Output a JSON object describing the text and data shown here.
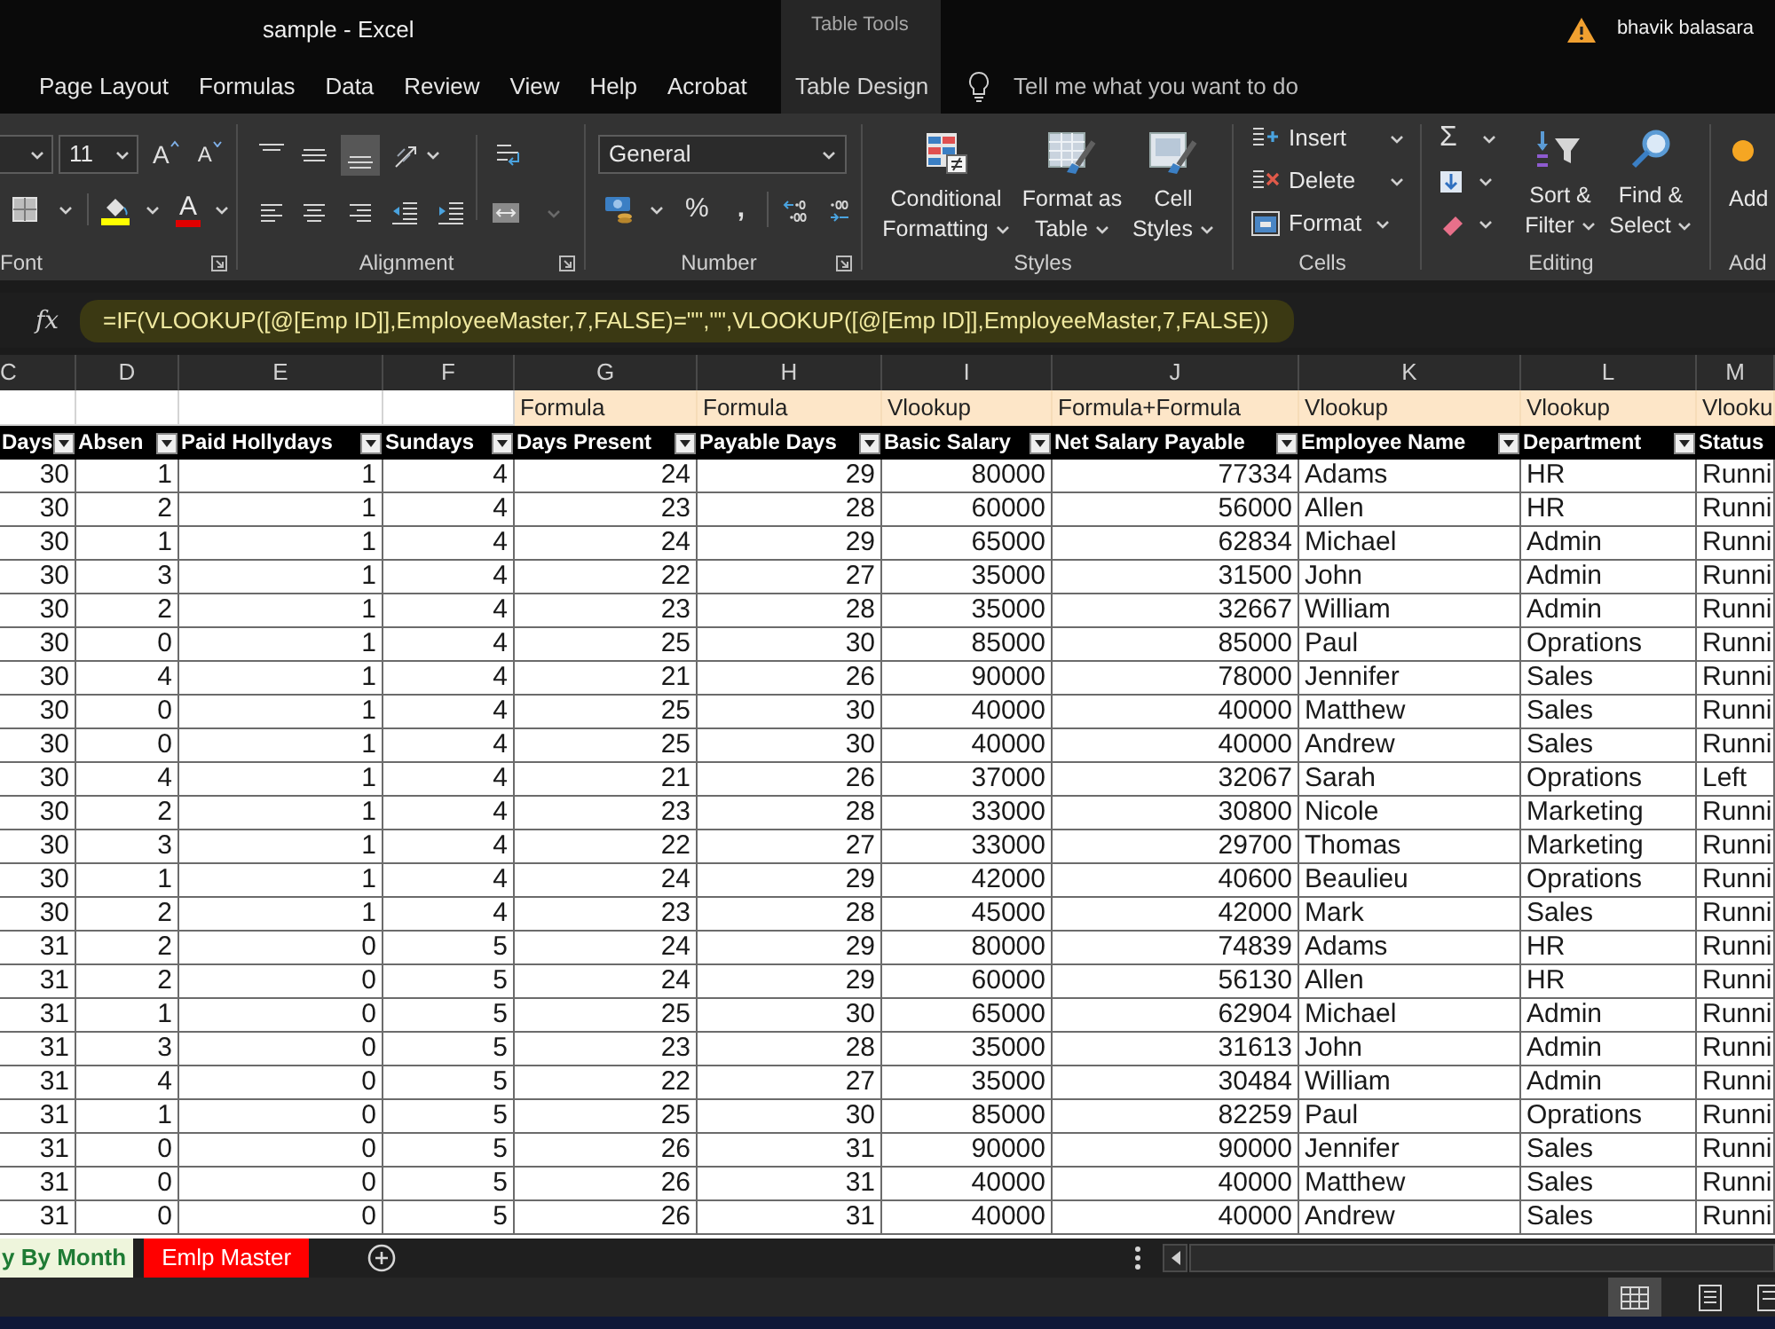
{
  "title_bar": {
    "title": "sample - Excel",
    "context_label": "Table Tools",
    "user": "bhavik balasara"
  },
  "tabs": [
    {
      "label": "Page Layout",
      "kind": "normal"
    },
    {
      "label": "Formulas",
      "kind": "normal"
    },
    {
      "label": "Data",
      "kind": "normal"
    },
    {
      "label": "Review",
      "kind": "normal"
    },
    {
      "label": "View",
      "kind": "normal"
    },
    {
      "label": "Help",
      "kind": "normal"
    },
    {
      "label": "Acrobat",
      "kind": "normal"
    },
    {
      "label": "Table Design",
      "kind": "contextual"
    }
  ],
  "tell_me": {
    "placeholder": "Tell me what you want to do"
  },
  "ribbon": {
    "font": {
      "size": "11",
      "grow": "A",
      "shrink": "A",
      "font_color": "A",
      "label": "Font"
    },
    "alignment": {
      "vertical": [
        {
          "selected": false
        },
        {
          "selected": false
        },
        {
          "selected": true
        }
      ],
      "horizontal": [
        {
          "selected": false
        },
        {
          "selected": false
        },
        {
          "selected": false
        }
      ],
      "label": "Alignment"
    },
    "number": {
      "format": "General",
      "percent": "%",
      "comma": ",",
      "label": "Number"
    },
    "styles": {
      "buttons": [
        {
          "lines": [
            "Conditional",
            "Formatting"
          ]
        },
        {
          "lines": [
            "Format as",
            "Table"
          ]
        },
        {
          "lines": [
            "Cell",
            "Styles"
          ]
        }
      ],
      "label": "Styles"
    },
    "cells": {
      "buttons": [
        "Insert",
        "Delete",
        "Format"
      ],
      "label": "Cells"
    },
    "editing": {
      "autosum": "Σ",
      "buttons": [
        {
          "lines": [
            "Sort &",
            "Filter"
          ]
        },
        {
          "lines": [
            "Find &",
            "Select"
          ]
        }
      ],
      "label": "Editing"
    },
    "add_ins": {
      "button": "Add",
      "label": "Add"
    }
  },
  "formula_bar": {
    "fx": "fx",
    "formula": "=IF(VLOOKUP([@[Emp ID]],EmployeeMaster,7,FALSE)=\"\",\"\",VLOOKUP([@[Emp ID]],EmployeeMaster,7,FALSE))"
  },
  "sheet": {
    "columns": [
      {
        "letter": "C",
        "header": "Days",
        "filter": true
      },
      {
        "letter": "D",
        "header": "Absen",
        "filter": true
      },
      {
        "letter": "E",
        "header": "Paid Hollydays",
        "filter": true
      },
      {
        "letter": "F",
        "header": "Sundays",
        "filter": true
      },
      {
        "letter": "G",
        "note": "Formula",
        "header": "Days Present",
        "filter": true
      },
      {
        "letter": "H",
        "note": "Formula",
        "header": "Payable Days",
        "filter": true
      },
      {
        "letter": "I",
        "note": "Vlookup",
        "header": "Basic Salary",
        "filter": true
      },
      {
        "letter": "J",
        "note": "Formula+Formula",
        "header": "Net Salary Payable",
        "filter": true
      },
      {
        "letter": "K",
        "note": "Vlookup",
        "header": "Employee Name",
        "filter": true
      },
      {
        "letter": "L",
        "note": "Vlookup",
        "header": "Department",
        "filter": true
      },
      {
        "letter": "M",
        "note": "Vlooku",
        "header": "Status"
      }
    ],
    "rows": [
      [
        "30",
        "1",
        "1",
        "4",
        "24",
        "29",
        "80000",
        "77334",
        "Adams",
        "HR",
        "Runni"
      ],
      [
        "30",
        "2",
        "1",
        "4",
        "23",
        "28",
        "60000",
        "56000",
        "Allen",
        "HR",
        "Runni"
      ],
      [
        "30",
        "1",
        "1",
        "4",
        "24",
        "29",
        "65000",
        "62834",
        "Michael",
        "Admin",
        "Runni"
      ],
      [
        "30",
        "3",
        "1",
        "4",
        "22",
        "27",
        "35000",
        "31500",
        "John",
        "Admin",
        "Runni"
      ],
      [
        "30",
        "2",
        "1",
        "4",
        "23",
        "28",
        "35000",
        "32667",
        "William",
        "Admin",
        "Runni"
      ],
      [
        "30",
        "0",
        "1",
        "4",
        "25",
        "30",
        "85000",
        "85000",
        "Paul",
        "Oprations",
        "Runni"
      ],
      [
        "30",
        "4",
        "1",
        "4",
        "21",
        "26",
        "90000",
        "78000",
        "Jennifer",
        "Sales",
        "Runni"
      ],
      [
        "30",
        "0",
        "1",
        "4",
        "25",
        "30",
        "40000",
        "40000",
        "Matthew",
        "Sales",
        "Runni"
      ],
      [
        "30",
        "0",
        "1",
        "4",
        "25",
        "30",
        "40000",
        "40000",
        "Andrew",
        "Sales",
        "Runni"
      ],
      [
        "30",
        "4",
        "1",
        "4",
        "21",
        "26",
        "37000",
        "32067",
        "Sarah",
        "Oprations",
        "Left"
      ],
      [
        "30",
        "2",
        "1",
        "4",
        "23",
        "28",
        "33000",
        "30800",
        "Nicole",
        "Marketing",
        "Runni"
      ],
      [
        "30",
        "3",
        "1",
        "4",
        "22",
        "27",
        "33000",
        "29700",
        "Thomas",
        "Marketing",
        "Runni"
      ],
      [
        "30",
        "1",
        "1",
        "4",
        "24",
        "29",
        "42000",
        "40600",
        "Beaulieu",
        "Oprations",
        "Runni"
      ],
      [
        "30",
        "2",
        "1",
        "4",
        "23",
        "28",
        "45000",
        "42000",
        "Mark",
        "Sales",
        "Runni"
      ],
      [
        "31",
        "2",
        "0",
        "5",
        "24",
        "29",
        "80000",
        "74839",
        "Adams",
        "HR",
        "Runni"
      ],
      [
        "31",
        "2",
        "0",
        "5",
        "24",
        "29",
        "60000",
        "56130",
        "Allen",
        "HR",
        "Runni"
      ],
      [
        "31",
        "1",
        "0",
        "5",
        "25",
        "30",
        "65000",
        "62904",
        "Michael",
        "Admin",
        "Runni"
      ],
      [
        "31",
        "3",
        "0",
        "5",
        "23",
        "28",
        "35000",
        "31613",
        "John",
        "Admin",
        "Runni"
      ],
      [
        "31",
        "4",
        "0",
        "5",
        "22",
        "27",
        "35000",
        "30484",
        "William",
        "Admin",
        "Runni"
      ],
      [
        "31",
        "1",
        "0",
        "5",
        "25",
        "30",
        "85000",
        "82259",
        "Paul",
        "Oprations",
        "Runni"
      ],
      [
        "31",
        "0",
        "0",
        "5",
        "26",
        "31",
        "90000",
        "90000",
        "Jennifer",
        "Sales",
        "Runni"
      ],
      [
        "31",
        "0",
        "0",
        "5",
        "26",
        "31",
        "40000",
        "40000",
        "Matthew",
        "Sales",
        "Runni"
      ],
      [
        "31",
        "0",
        "0",
        "5",
        "26",
        "31",
        "40000",
        "40000",
        "Andrew",
        "Sales",
        "Runni"
      ]
    ]
  },
  "sheet_tabs": [
    {
      "label": "y By Month",
      "selected": true
    },
    {
      "label": "Emlp Master",
      "selected": false,
      "color": "#ff0000"
    }
  ],
  "view_buttons": [
    {
      "selected": true
    },
    {
      "selected": false
    },
    {
      "selected": false
    }
  ]
}
